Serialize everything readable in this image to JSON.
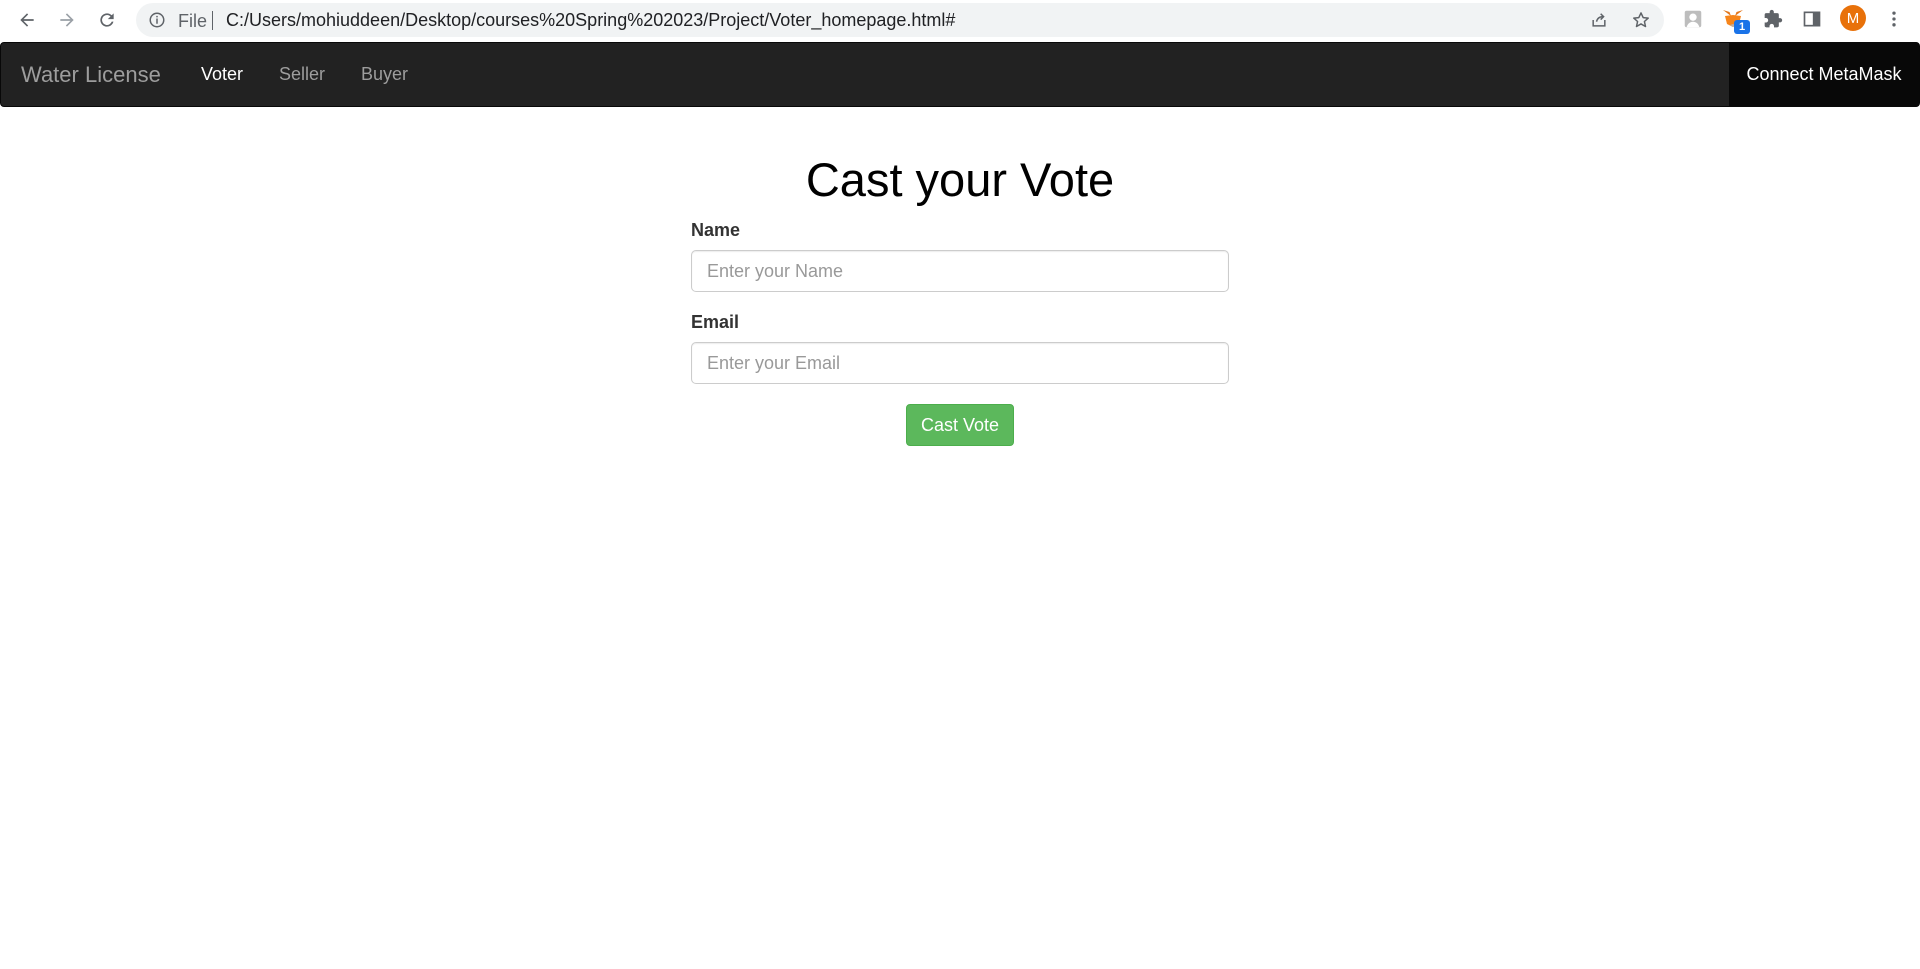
{
  "browser": {
    "scheme_label": "File",
    "url": "C:/Users/mohiuddeen/Desktop/courses%20Spring%202023/Project/Voter_homepage.html#",
    "profile_initial": "M",
    "extension_badge_count": "1"
  },
  "navbar": {
    "brand": "Water License",
    "links": [
      {
        "label": "Voter",
        "active": true
      },
      {
        "label": "Seller",
        "active": false
      },
      {
        "label": "Buyer",
        "active": false
      }
    ],
    "connect_label": "Connect MetaMask"
  },
  "form": {
    "title": "Cast your Vote",
    "name_label": "Name",
    "name_placeholder": "Enter your Name",
    "email_label": "Email",
    "email_placeholder": "Enter your Email",
    "submit_label": "Cast Vote"
  },
  "colors": {
    "navbar_bg": "#222222",
    "button_green": "#5cb85c",
    "avatar_orange": "#e8710a"
  }
}
